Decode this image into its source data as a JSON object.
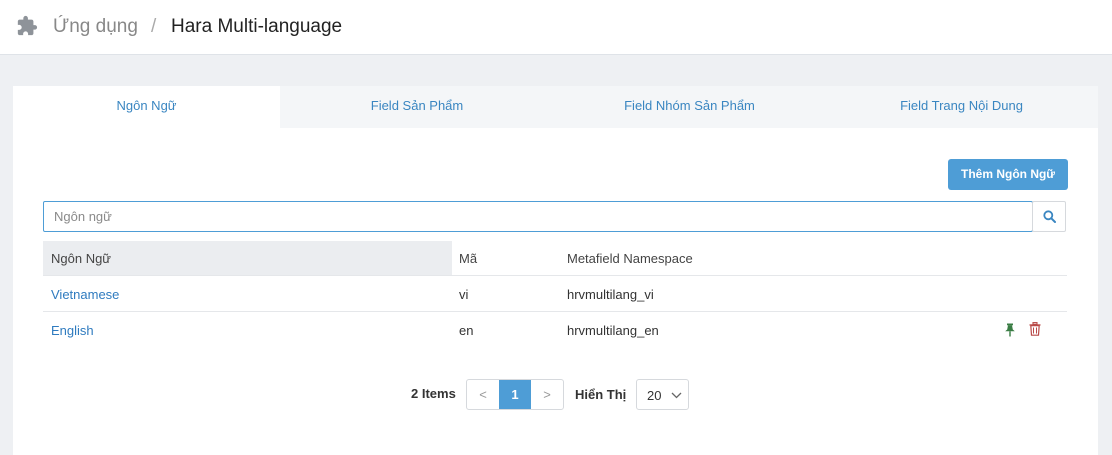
{
  "breadcrumb": {
    "icon": "puzzle-icon",
    "parent": "Ứng dụng",
    "separator": "/",
    "current": "Hara Multi-language"
  },
  "tabs": [
    {
      "label": "Ngôn Ngữ",
      "active": true
    },
    {
      "label": "Field Sản Phẩm",
      "active": false
    },
    {
      "label": "Field Nhóm Sản Phẩm",
      "active": false
    },
    {
      "label": "Field Trang Nội Dung",
      "active": false
    }
  ],
  "toolbar": {
    "add_label": "Thêm Ngôn Ngữ"
  },
  "search": {
    "placeholder": "Ngôn ngữ",
    "value": "",
    "icon": "search-icon"
  },
  "table": {
    "headers": [
      "Ngôn Ngữ",
      "Mã",
      "Metafield Namespace"
    ],
    "rows": [
      {
        "language": "Vietnamese",
        "code": "vi",
        "namespace": "hrvmultilang_vi",
        "actions": []
      },
      {
        "language": "English",
        "code": "en",
        "namespace": "hrvmultilang_en",
        "actions": [
          "pin-icon",
          "trash-icon"
        ]
      }
    ]
  },
  "pagination": {
    "items_label": "2 Items",
    "prev": "<",
    "current_page": "1",
    "next": ">",
    "show_label": "Hiển Thị",
    "page_size": "20"
  },
  "colors": {
    "accent": "#4e9dd6",
    "link": "#2f7bbf",
    "pin": "#3a7d44",
    "trash": "#b94a48"
  }
}
